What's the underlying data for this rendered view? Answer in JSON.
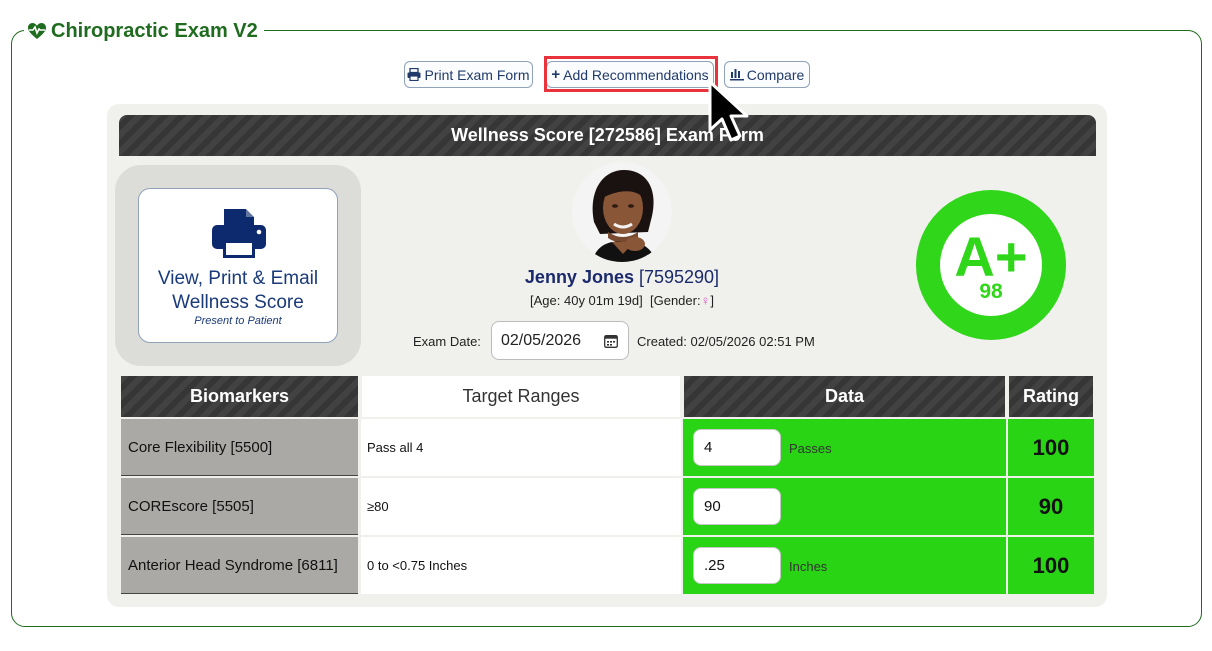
{
  "section": {
    "title": "Chiropractic Exam V2",
    "icon": "heartbeat-icon"
  },
  "toolbar": {
    "print_label": "Print Exam Form",
    "add_label": "Add Recommendations",
    "compare_label": "Compare"
  },
  "form": {
    "title": "Wellness Score [272586] Exam Form"
  },
  "view_print": {
    "line1": "View, Print & Email",
    "line2": "Wellness Score",
    "subtitle": "Present to Patient"
  },
  "patient": {
    "name": "Jenny Jones",
    "id": "[7595290]",
    "age_text": "[Age: 40y 01m 19d]",
    "gender_label": "[Gender:",
    "gender_symbol": "♀",
    "gender_close": "]"
  },
  "exam": {
    "date_label": "Exam Date:",
    "date_value": "02/05/2026",
    "created_text": "Created: 02/05/2026 02:51 PM"
  },
  "grade": {
    "letter": "A+",
    "score": "98",
    "color": "#2fd619"
  },
  "table": {
    "headers": [
      "Biomarkers",
      "Target Ranges",
      "Data",
      "Rating"
    ],
    "rows": [
      {
        "biomarker": "Core Flexibility [5500]",
        "target": "Pass all 4",
        "value": "4",
        "unit": "Passes",
        "rating": "100"
      },
      {
        "biomarker": "COREscore [5505]",
        "target": "≥80",
        "value": "90",
        "unit": "",
        "rating": "90"
      },
      {
        "biomarker": "Anterior Head Syndrome [6811]",
        "target": "0 to <0.75 Inches",
        "value": ".25",
        "unit": "Inches",
        "rating": "100"
      }
    ]
  },
  "colors": {
    "accent_green": "#1f6b1f",
    "rating_green": "#29d414",
    "highlight_red": "#e8333c",
    "link_blue": "#1a2a6c"
  }
}
